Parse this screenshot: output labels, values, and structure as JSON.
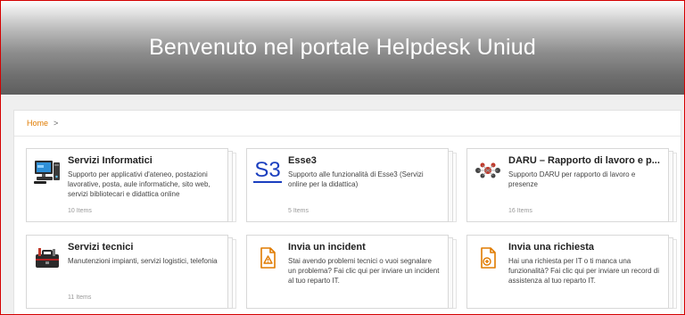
{
  "hero": {
    "title": "Benvenuto nel portale Helpdesk Uniud"
  },
  "breadcrumb": {
    "home": "Home",
    "separator": ">"
  },
  "cards": [
    {
      "title": "Servizi Informatici",
      "description": "Supporto per applicativi d'ateneo, postazioni lavorative, posta, aule informatiche, sito web, servizi bibliotecari e didattica online",
      "count": "10 Items",
      "icon": "computer-icon"
    },
    {
      "title": "Esse3",
      "description": "Supporto alle funzionalità di Esse3 (Servizi online per la didattica)",
      "count": "5 Items",
      "icon_text": "S3",
      "icon": "esse3-logo-icon"
    },
    {
      "title": "DARU – Rapporto di lavoro e p...",
      "description": "Supporto DARU per rapporto di lavoro e presenze",
      "count": "16 Items",
      "icon": "people-network-icon"
    },
    {
      "title": "Servizi tecnici",
      "description": "Manutenzioni impianti, servizi logistici, telefonia",
      "count": "11 Items",
      "icon": "toolbox-icon"
    },
    {
      "title": "Invia un incident",
      "description": "Stai avendo problemi tecnici o vuoi segnalare un problema? Fai clic qui per inviare un incident al tuo reparto IT.",
      "icon": "incident-document-icon"
    },
    {
      "title": "Invia una richiesta",
      "description": "Hai una richiesta per IT o ti manca una funzionalità? Fai clic qui per inviare un record di assistenza al tuo reparto IT.",
      "icon": "request-document-icon"
    }
  ],
  "colors": {
    "accent": "#e07b00",
    "esse3_blue": "#1b3fbf",
    "frame_red": "#d40000"
  }
}
